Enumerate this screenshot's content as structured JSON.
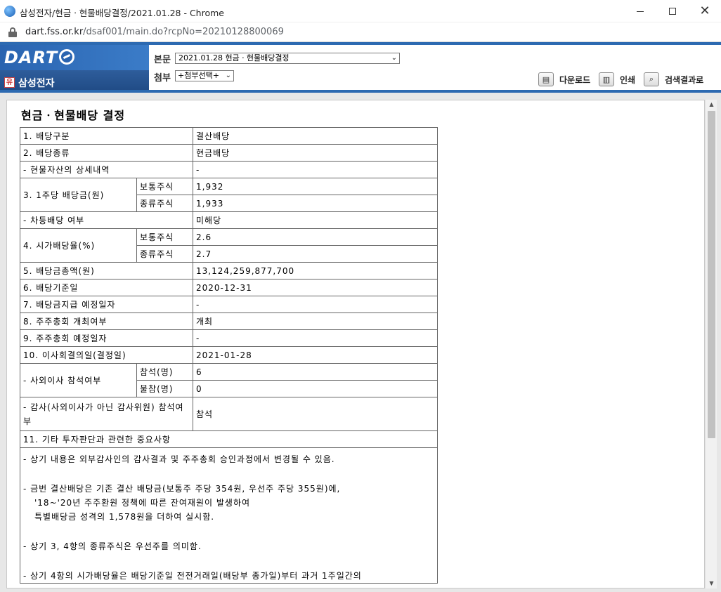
{
  "window": {
    "title": "삼성전자/현금ㆍ현물배당결정/2021.01.28 - Chrome",
    "url_host": "dart.fss.or.kr",
    "url_path": "/dsaf001/main.do?rcpNo=20210128800069"
  },
  "header": {
    "logo": "DART",
    "company_badge": "유",
    "company_name": "삼성전자",
    "main_label": "본문",
    "main_select_value": "2021.01.28  현금ㆍ현물배당결정",
    "attach_label": "첨부",
    "attach_select_value": "+첨부선택+",
    "tools": {
      "download": "다운로드",
      "print": "인쇄",
      "search_results": "검색결과로"
    }
  },
  "document": {
    "title": "현금ㆍ현물배당 결정",
    "rows": {
      "r1_label": "1. 배당구분",
      "r1_value": "결산배당",
      "r2_label": "2. 배당종류",
      "r2_value": "현금배당",
      "r3_label": "- 현물자산의 상세내역",
      "r3_value": "-",
      "r4_label": "3. 1주당 배당금(원)",
      "r4_sub1": "보통주식",
      "r4_val1": "1,932",
      "r4_sub2": "종류주식",
      "r4_val2": "1,933",
      "r5_label": "- 차등배당 여부",
      "r5_value": "미해당",
      "r6_label": "4. 시가배당율(%)",
      "r6_sub1": "보통주식",
      "r6_val1": "2.6",
      "r6_sub2": "종류주식",
      "r6_val2": "2.7",
      "r7_label": "5. 배당금총액(원)",
      "r7_value": "13,124,259,877,700",
      "r8_label": "6. 배당기준일",
      "r8_value": "2020-12-31",
      "r9_label": "7. 배당금지급 예정일자",
      "r9_value": "-",
      "r10_label": "8. 주주총회 개최여부",
      "r10_value": "개최",
      "r11_label": "9. 주주총회 예정일자",
      "r11_value": "-",
      "r12_label": "10. 이사회결의일(결정일)",
      "r12_value": "2021-01-28",
      "r13_label": "- 사외이사 참석여부",
      "r13_sub1": "참석(명)",
      "r13_val1": "6",
      "r13_sub2": "불참(명)",
      "r13_val2": "0",
      "r14_label": "- 감사(사외이사가 아닌 감사위원) 참석여부",
      "r14_value": "참석",
      "r15_label": "11. 기타 투자판단과 관련한 중요사항"
    },
    "notes": {
      "n1": "- 상기 내용은 외부감사인의 감사결과 및 주주총회 승인과정에서 변경될 수 있음.",
      "n2a": "- 금번 결산배당은 기존 결산 배당금(보통주 주당 354원, 우선주 주당 355원)에,",
      "n2b": "'18~'20년 주주환원 정책에 따른 잔여재원이 발생하여",
      "n2c": "특별배당금 성격의 1,578원을 더하여 실시함.",
      "n3": "- 상기 3, 4항의 종류주식은 우선주를 의미함.",
      "n4": "- 상기 4항의 시가배당율은 배당기준일 전전거래일(배당부 종가일)부터 과거 1주일간의"
    }
  }
}
